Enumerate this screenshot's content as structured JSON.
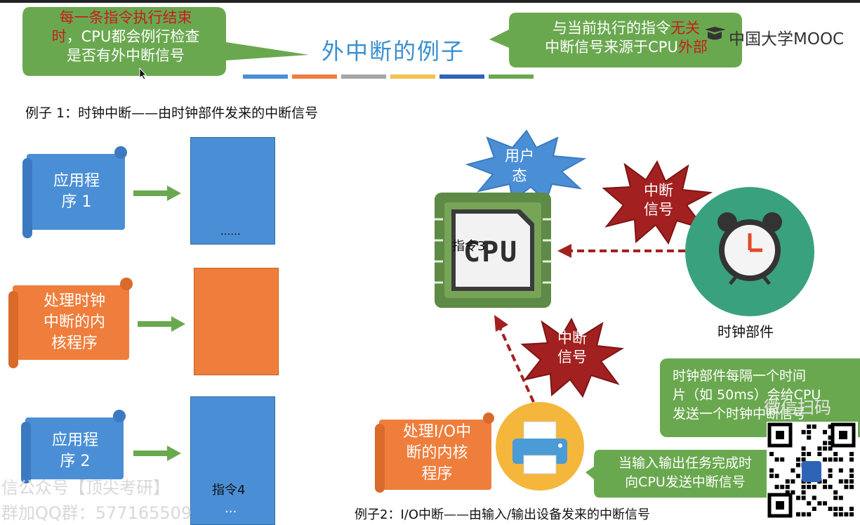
{
  "title": "外中断的例子",
  "callout_left": {
    "line1": "每一条指令执行结束",
    "line2_red": "时",
    "line2_rest": "，CPU都会例行检查",
    "line3": "是否有外中断信号"
  },
  "callout_right": {
    "line1_a": "与当前执行的指令",
    "line1_red": "无关",
    "line2_a": "中断信号来源于CPU",
    "line2_red": "外部"
  },
  "logo": "中国大学MOOC",
  "example1": "例子 1：时钟中断——由时钟部件发来的中断信号",
  "example2": "例子2：I/O中断——由输入/输出设备发来的中断信号",
  "scroll1": {
    "line1": "应用程",
    "line2": "序 1"
  },
  "scroll2": {
    "line1": "处理时钟",
    "line2": "中断的内",
    "line3": "核程序"
  },
  "scroll3": {
    "line1": "应用程",
    "line2": "序 2"
  },
  "scroll4": {
    "line1": "处理I/O中",
    "line2": "断的内核",
    "line3": "程序"
  },
  "block1_text": "......",
  "block3_text": "指令4",
  "block3_more": "...",
  "user_mode": {
    "line1": "用户",
    "line2": "态"
  },
  "cpu_label": "CPU",
  "instr3": "指令3",
  "burst_signal": {
    "line1": "中断",
    "line2": "信号"
  },
  "clock_label": "时钟部件",
  "clock_note": {
    "line1": "时钟部件每隔一个时间",
    "line2": "片（如 50ms）会给CPU",
    "line3": "发送一个时钟中断信号"
  },
  "io_note": {
    "line1": "当输入输出任务完成时",
    "line2": "向CPU发送中断信号"
  },
  "watermark1": "信公众号【顶尖考研】",
  "watermark2": "群加QQ群：577165509",
  "watermark3": "微信扫码",
  "colors": {
    "blue": "#4a8fd6",
    "orange": "#ef7e3c",
    "green": "#6aa84f",
    "dark_red": "#a32020",
    "teal": "#3aa17e",
    "cpu_green": "#5d8a45"
  },
  "strip_colors": [
    "#4a8fd6",
    "#ef7e3c",
    "#a5a5a5",
    "#f2c14e",
    "#2e64b5",
    "#6aa84f"
  ]
}
